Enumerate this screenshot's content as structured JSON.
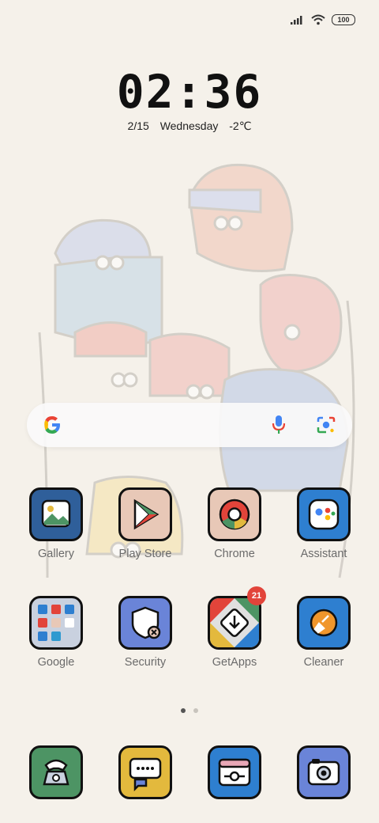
{
  "status": {
    "battery": "100"
  },
  "clock": {
    "time": "02:36",
    "date": "2/15",
    "weekday": "Wednesday",
    "temperature": "-2℃"
  },
  "search": {
    "google_icon": "google-g-icon",
    "mic_icon": "mic-icon",
    "lens_icon": "lens-camera-icon"
  },
  "row1": [
    {
      "label": "Gallery",
      "color": "#2f5f9a"
    },
    {
      "label": "Play Store",
      "color": "#e8c8b7"
    },
    {
      "label": "Chrome",
      "color": "#e8c8b7"
    },
    {
      "label": "Assistant",
      "color": "#2e7fd0"
    }
  ],
  "row2": [
    {
      "label": "Google",
      "color": "#c9d1df"
    },
    {
      "label": "Security",
      "color": "#6a84d8"
    },
    {
      "label": "GetApps",
      "color": "#e0e0e0",
      "badge": "21"
    },
    {
      "label": "Cleaner",
      "color": "#2e7fd0"
    }
  ],
  "dock": [
    {
      "icon": "phone-icon",
      "color": "#4d9464"
    },
    {
      "icon": "messages-icon",
      "color": "#e3b93d"
    },
    {
      "icon": "browser-icon",
      "color": "#2e7fd0"
    },
    {
      "icon": "camera-icon",
      "color": "#6a84d8"
    }
  ],
  "pages": {
    "count": 2,
    "active": 1
  }
}
